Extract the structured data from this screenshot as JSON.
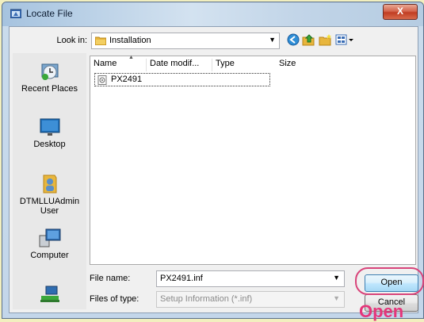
{
  "window": {
    "title": "Locate File",
    "close_label": "X"
  },
  "toolbar": {
    "look_in_label": "Look in:",
    "look_in_value": "Installation",
    "icons": [
      "back-icon",
      "up-folder-icon",
      "new-folder-icon",
      "view-menu-icon"
    ]
  },
  "places": [
    {
      "label": "Recent Places",
      "icon": "recent-places-icon"
    },
    {
      "label": "Desktop",
      "icon": "desktop-icon"
    },
    {
      "label": "DTMLLUAdmin User",
      "icon": "user-folder-icon"
    },
    {
      "label": "Computer",
      "icon": "computer-icon"
    },
    {
      "label": "",
      "icon": "network-icon"
    }
  ],
  "columns": [
    "Name",
    "Date modif...",
    "Type",
    "Size"
  ],
  "files": [
    {
      "name": "PX2491",
      "icon": "setup-info-file-icon"
    }
  ],
  "file_name": {
    "label": "File name:",
    "value": "PX2491.inf"
  },
  "file_type": {
    "label": "Files of type:",
    "value": "Setup Information (*.inf)"
  },
  "buttons": {
    "open": "Open",
    "cancel": "Cancel"
  },
  "annotation": {
    "callout": "Open",
    "color": "#e5357a"
  }
}
